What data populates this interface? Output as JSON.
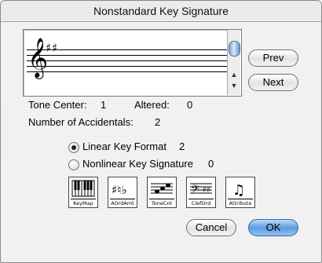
{
  "window": {
    "title": "Nonstandard Key Signature"
  },
  "preview": {
    "clef": "𝄞",
    "accidentals": "♯ ♯"
  },
  "nav": {
    "prev_label": "Prev",
    "next_label": "Next"
  },
  "info": {
    "tone_center_label": "Tone Center:",
    "tone_center_value": "1",
    "altered_label": "Altered:",
    "altered_value": "0",
    "num_accidentals_label": "Number of Accidentals:",
    "num_accidentals_value": "2"
  },
  "format": {
    "linear_label": "Linear Key Format",
    "linear_value": "2",
    "linear_selected": true,
    "nonlinear_label": "Nonlinear Key Signature",
    "nonlinear_value": "0",
    "nonlinear_selected": false
  },
  "tools": [
    {
      "caption": "KeyMap",
      "icon": "keyboard-icon"
    },
    {
      "caption": "AOrdAmt",
      "icon": "accidentals-icon"
    },
    {
      "caption": "ToneCnt",
      "icon": "tone-center-icon"
    },
    {
      "caption": "ClefOrd",
      "icon": "clef-order-icon"
    },
    {
      "caption": "Attribute",
      "icon": "attribute-icon"
    }
  ],
  "footer": {
    "cancel_label": "Cancel",
    "ok_label": "OK"
  },
  "colors": {
    "default_button": "#5f9ce0",
    "scroll_thumb": "#7aa8d8"
  }
}
